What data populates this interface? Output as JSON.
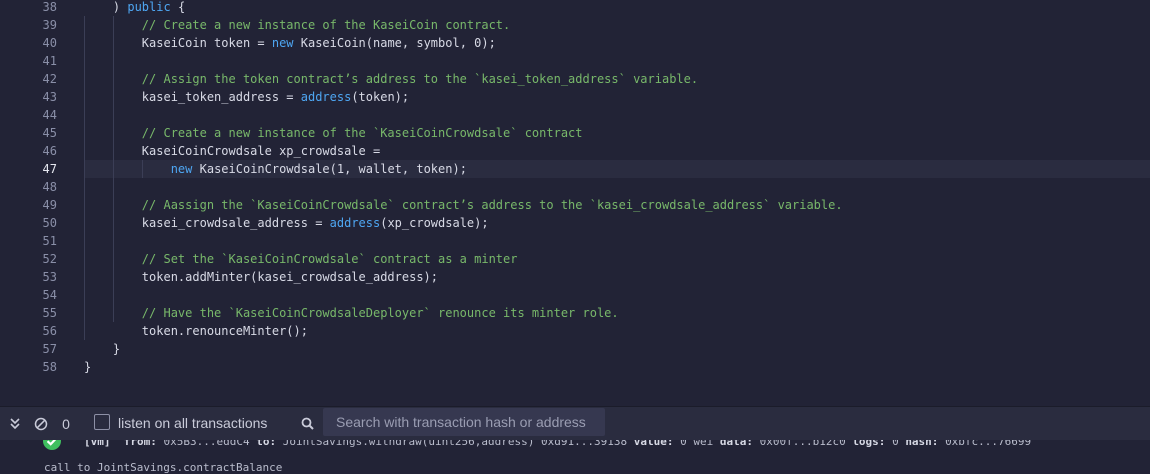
{
  "editor": {
    "active_line": 47,
    "lines": [
      {
        "no": "38",
        "tokens": [
          {
            "t": "    ) ",
            "c": "p"
          },
          {
            "t": "public",
            "c": "k"
          },
          {
            "t": " {",
            "c": "p"
          }
        ]
      },
      {
        "no": "39",
        "tokens": [
          {
            "t": "        // Create a new instance of the KaseiCoin contract.",
            "c": "c"
          }
        ]
      },
      {
        "no": "40",
        "tokens": [
          {
            "t": "        KaseiCoin token = ",
            "c": "p"
          },
          {
            "t": "new",
            "c": "k"
          },
          {
            "t": " KaseiCoin(name, symbol, 0);",
            "c": "p"
          }
        ]
      },
      {
        "no": "41",
        "tokens": []
      },
      {
        "no": "42",
        "tokens": [
          {
            "t": "        // Assign the token contract’s address to the `kasei_token_address` variable.",
            "c": "c"
          }
        ]
      },
      {
        "no": "43",
        "tokens": [
          {
            "t": "        kasei_token_address = ",
            "c": "p"
          },
          {
            "t": "address",
            "c": "k"
          },
          {
            "t": "(token);",
            "c": "p"
          }
        ]
      },
      {
        "no": "44",
        "tokens": []
      },
      {
        "no": "45",
        "tokens": [
          {
            "t": "        // Create a new instance of the `KaseiCoinCrowdsale` contract",
            "c": "c"
          }
        ]
      },
      {
        "no": "46",
        "tokens": [
          {
            "t": "        KaseiCoinCrowdsale xp_crowdsale =",
            "c": "p"
          }
        ]
      },
      {
        "no": "47",
        "tokens": [
          {
            "t": "            ",
            "c": "p"
          },
          {
            "t": "new",
            "c": "k"
          },
          {
            "t": " KaseiCoinCrowdsale(1, wallet, token);",
            "c": "p"
          }
        ]
      },
      {
        "no": "48",
        "tokens": []
      },
      {
        "no": "49",
        "tokens": [
          {
            "t": "        // Aassign the `KaseiCoinCrowdsale` contract’s address to the `kasei_crowdsale_address` variable.",
            "c": "c"
          }
        ]
      },
      {
        "no": "50",
        "tokens": [
          {
            "t": "        kasei_crowdsale_address = ",
            "c": "p"
          },
          {
            "t": "address",
            "c": "k"
          },
          {
            "t": "(xp_crowdsale);",
            "c": "p"
          }
        ]
      },
      {
        "no": "51",
        "tokens": []
      },
      {
        "no": "52",
        "tokens": [
          {
            "t": "        // Set the `KaseiCoinCrowdsale` contract as a minter",
            "c": "c"
          }
        ]
      },
      {
        "no": "53",
        "tokens": [
          {
            "t": "        token.addMinter(kasei_crowdsale_address);",
            "c": "p"
          }
        ]
      },
      {
        "no": "54",
        "tokens": []
      },
      {
        "no": "55",
        "tokens": [
          {
            "t": "        // Have the `KaseiCoinCrowdsaleDeployer` renounce its minter role.",
            "c": "c"
          }
        ]
      },
      {
        "no": "56",
        "tokens": [
          {
            "t": "        token.renounceMinter();",
            "c": "p"
          }
        ]
      },
      {
        "no": "57",
        "tokens": [
          {
            "t": "    }",
            "c": "p"
          }
        ]
      },
      {
        "no": "58",
        "tokens": [
          {
            "t": "}",
            "c": "p"
          }
        ]
      }
    ]
  },
  "terminal": {
    "collapse_icon": "double-chevron-down-icon",
    "clear_icon": "clear-circle-icon",
    "pending_count": "0",
    "listen_label": "listen on all transactions",
    "search_icon": "magnifier-icon",
    "search_placeholder": "Search with transaction hash or address",
    "log": {
      "status_icon": "check-circle-icon",
      "vm_tag": "[vm]",
      "from_label": "from:",
      "from_value": "0x5B3...eddC4",
      "to_label": "to:",
      "to_value": "JointSavings.withdraw(uint256,address) 0xd91...39138",
      "value_label": "value:",
      "value_value": "0 wei",
      "data_label": "data:",
      "data_value": "0x00f...b12c0",
      "logs_label": "logs:",
      "logs_value": "0",
      "hash_label": "hash:",
      "hash_value": "0xbfc...76699",
      "call_text": "call to JointSavings.contractBalance"
    }
  },
  "colors": {
    "background": "#222336",
    "keyword": "#4ea6f2",
    "comment": "#78b86a",
    "success": "#3fbf5f"
  }
}
